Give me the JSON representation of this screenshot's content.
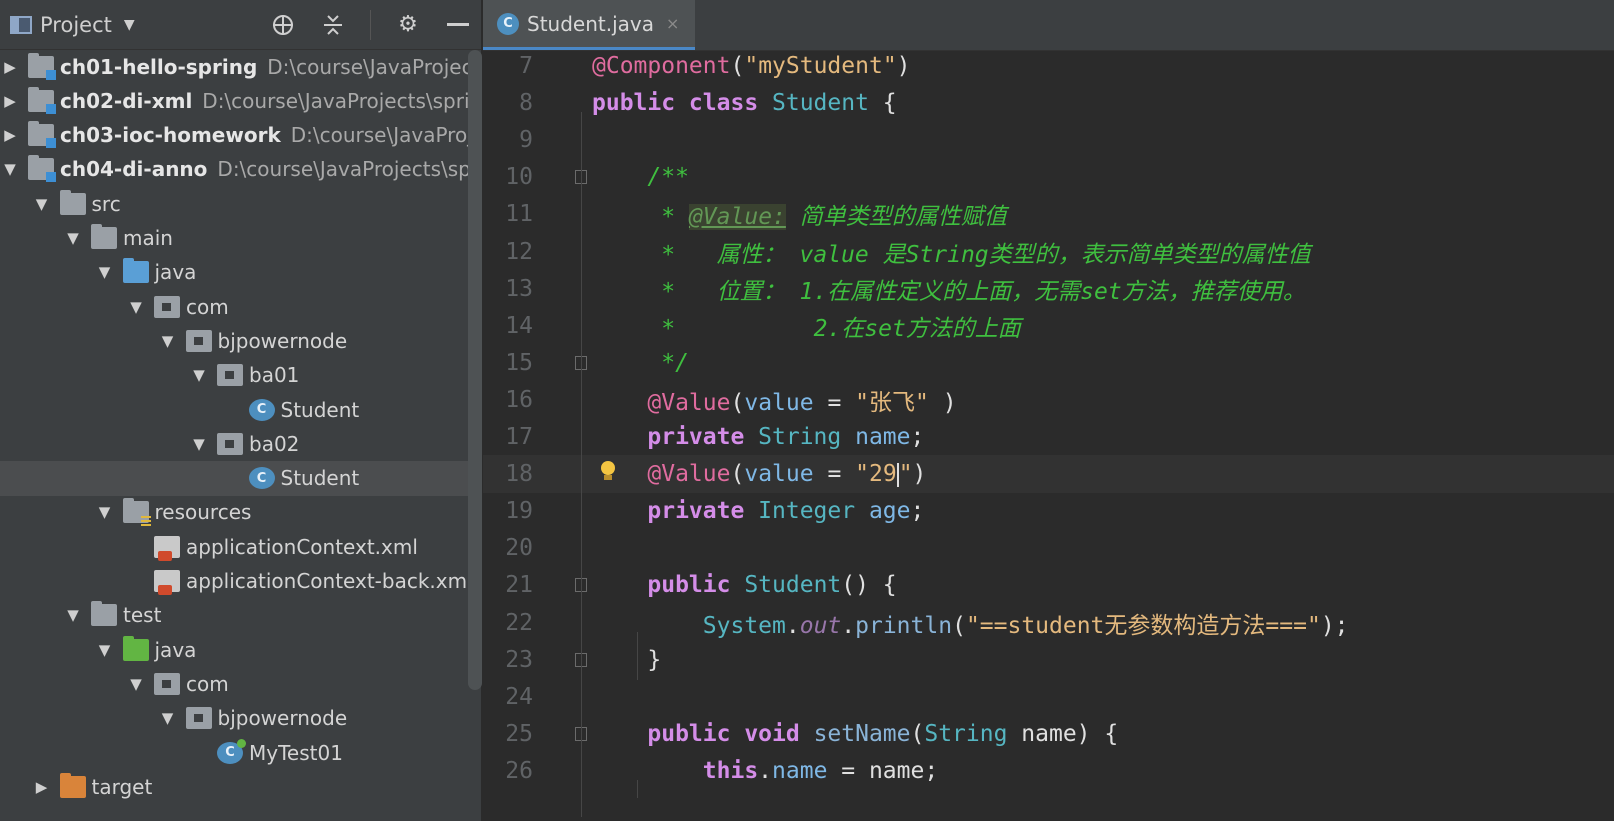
{
  "panel": {
    "title": "Project",
    "tools": [
      "crosshair-icon",
      "collapse-icon",
      "gear-icon",
      "minimize-icon"
    ]
  },
  "tree": [
    {
      "label": "ch01-hello-spring",
      "path": "D:\\course\\JavaProjects\\s",
      "icon": "module",
      "bold": true,
      "indent": 0,
      "arrow": "right"
    },
    {
      "label": "ch02-di-xml",
      "path": "D:\\course\\JavaProjects\\spring",
      "icon": "module",
      "bold": true,
      "indent": 0,
      "arrow": "right"
    },
    {
      "label": "ch03-ioc-homework",
      "path": "D:\\course\\JavaProject",
      "icon": "module",
      "bold": true,
      "indent": 0,
      "arrow": "right"
    },
    {
      "label": "ch04-di-anno",
      "path": "D:\\course\\JavaProjects\\sprin",
      "icon": "module",
      "bold": true,
      "indent": 0,
      "arrow": "down"
    },
    {
      "label": "src",
      "path": "",
      "icon": "folder",
      "bold": false,
      "indent": 1,
      "arrow": "down"
    },
    {
      "label": "main",
      "path": "",
      "icon": "folder",
      "bold": false,
      "indent": 2,
      "arrow": "down"
    },
    {
      "label": "java",
      "path": "",
      "icon": "folder-blue",
      "bold": false,
      "indent": 3,
      "arrow": "down"
    },
    {
      "label": "com",
      "path": "",
      "icon": "package",
      "bold": false,
      "indent": 4,
      "arrow": "down"
    },
    {
      "label": "bjpowernode",
      "path": "",
      "icon": "package",
      "bold": false,
      "indent": 5,
      "arrow": "down"
    },
    {
      "label": "ba01",
      "path": "",
      "icon": "package",
      "bold": false,
      "indent": 6,
      "arrow": "down"
    },
    {
      "label": "Student",
      "path": "",
      "icon": "class",
      "bold": false,
      "indent": 7,
      "arrow": ""
    },
    {
      "label": "ba02",
      "path": "",
      "icon": "package",
      "bold": false,
      "indent": 6,
      "arrow": "down"
    },
    {
      "label": "Student",
      "path": "",
      "icon": "class",
      "bold": false,
      "indent": 7,
      "arrow": "",
      "selected": true
    },
    {
      "label": "resources",
      "path": "",
      "icon": "resources",
      "bold": false,
      "indent": 3,
      "arrow": "down"
    },
    {
      "label": "applicationContext.xml",
      "path": "",
      "icon": "xml",
      "bold": false,
      "indent": 4,
      "arrow": ""
    },
    {
      "label": "applicationContext-back.xml",
      "path": "",
      "icon": "xml",
      "bold": false,
      "indent": 4,
      "arrow": ""
    },
    {
      "label": "test",
      "path": "",
      "icon": "folder",
      "bold": false,
      "indent": 2,
      "arrow": "down"
    },
    {
      "label": "java",
      "path": "",
      "icon": "folder-green",
      "bold": false,
      "indent": 3,
      "arrow": "down"
    },
    {
      "label": "com",
      "path": "",
      "icon": "package",
      "bold": false,
      "indent": 4,
      "arrow": "down"
    },
    {
      "label": "bjpowernode",
      "path": "",
      "icon": "package",
      "bold": false,
      "indent": 5,
      "arrow": "down"
    },
    {
      "label": "MyTest01",
      "path": "",
      "icon": "test-class",
      "bold": false,
      "indent": 6,
      "arrow": ""
    },
    {
      "label": "target",
      "path": "",
      "icon": "folder-orange",
      "bold": false,
      "indent": 1,
      "arrow": "right"
    }
  ],
  "editor": {
    "tab_label": "Student.java",
    "tab_close": "×",
    "current_line": 18,
    "lines": [
      {
        "n": "7",
        "parts": [
          [
            "annp",
            "@Component"
          ],
          [
            "plain",
            "("
          ],
          [
            "strg",
            "\"myStudent\""
          ],
          [
            "plain",
            ")"
          ]
        ]
      },
      {
        "n": "8",
        "parts": [
          [
            "kwb",
            "public class "
          ],
          [
            "type",
            "Student"
          ],
          [
            "plain",
            " {"
          ]
        ]
      },
      {
        "n": "9",
        "parts": []
      },
      {
        "n": "10",
        "parts": [
          [
            "plain",
            "    "
          ],
          [
            "grn",
            "/**"
          ]
        ]
      },
      {
        "n": "11",
        "parts": [
          [
            "plain",
            "     "
          ],
          [
            "grn",
            "* "
          ],
          [
            "tag",
            "@Value:"
          ],
          [
            "grn",
            " 简单类型的属性赋值"
          ]
        ]
      },
      {
        "n": "12",
        "parts": [
          [
            "plain",
            "     "
          ],
          [
            "grn",
            "*   属性： value 是String类型的，表示简单类型的属性值"
          ]
        ]
      },
      {
        "n": "13",
        "parts": [
          [
            "plain",
            "     "
          ],
          [
            "grn",
            "*   位置： 1.在属性定义的上面，无需set方法，推荐使用。"
          ]
        ]
      },
      {
        "n": "14",
        "parts": [
          [
            "plain",
            "     "
          ],
          [
            "grn",
            "*          2.在set方法的上面"
          ]
        ]
      },
      {
        "n": "15",
        "parts": [
          [
            "plain",
            "     "
          ],
          [
            "grn",
            "*/"
          ]
        ]
      },
      {
        "n": "16",
        "parts": [
          [
            "plain",
            "    "
          ],
          [
            "annp",
            "@Value"
          ],
          [
            "plain",
            "("
          ],
          [
            "nm",
            "value"
          ],
          [
            "plain",
            " = "
          ],
          [
            "strg",
            "\"张飞\""
          ],
          [
            "plain",
            " )"
          ]
        ]
      },
      {
        "n": "17",
        "parts": [
          [
            "plain",
            "    "
          ],
          [
            "kwb",
            "private "
          ],
          [
            "type",
            "String "
          ],
          [
            "nm",
            "name"
          ],
          [
            "plain",
            ";"
          ]
        ]
      },
      {
        "n": "18",
        "parts": [
          [
            "plain",
            "    "
          ],
          [
            "annp",
            "@Value"
          ],
          [
            "plain",
            "("
          ],
          [
            "nm",
            "value"
          ],
          [
            "plain",
            " = "
          ],
          [
            "strg",
            "\"29"
          ],
          [
            "caret",
            ""
          ],
          [
            "strg",
            "\""
          ],
          [
            "plain",
            ")"
          ]
        ]
      },
      {
        "n": "19",
        "parts": [
          [
            "plain",
            "    "
          ],
          [
            "kwb",
            "private "
          ],
          [
            "type",
            "Integer "
          ],
          [
            "nm",
            "age"
          ],
          [
            "plain",
            ";"
          ]
        ]
      },
      {
        "n": "20",
        "parts": []
      },
      {
        "n": "21",
        "parts": [
          [
            "plain",
            "    "
          ],
          [
            "kwb",
            "public "
          ],
          [
            "type",
            "Student"
          ],
          [
            "plain",
            "() {"
          ]
        ]
      },
      {
        "n": "22",
        "parts": [
          [
            "plain",
            "        "
          ],
          [
            "type",
            "System"
          ],
          [
            "plain",
            "."
          ],
          [
            "stat",
            "out"
          ],
          [
            "plain",
            "."
          ],
          [
            "mth",
            "println"
          ],
          [
            "plain",
            "("
          ],
          [
            "strg",
            "\"==student无参数构造方法===\""
          ],
          [
            "plain",
            ");"
          ]
        ]
      },
      {
        "n": "23",
        "parts": [
          [
            "plain",
            "    }"
          ]
        ]
      },
      {
        "n": "24",
        "parts": []
      },
      {
        "n": "25",
        "parts": [
          [
            "plain",
            "    "
          ],
          [
            "kwb",
            "public void "
          ],
          [
            "mth",
            "setName"
          ],
          [
            "plain",
            "("
          ],
          [
            "type",
            "String "
          ],
          [
            "plain",
            "name) {"
          ]
        ]
      },
      {
        "n": "26",
        "parts": [
          [
            "plain",
            "        "
          ],
          [
            "kwb",
            "this"
          ],
          [
            "plain",
            "."
          ],
          [
            "nm",
            "name"
          ],
          [
            "plain",
            " = name;"
          ]
        ]
      }
    ]
  }
}
